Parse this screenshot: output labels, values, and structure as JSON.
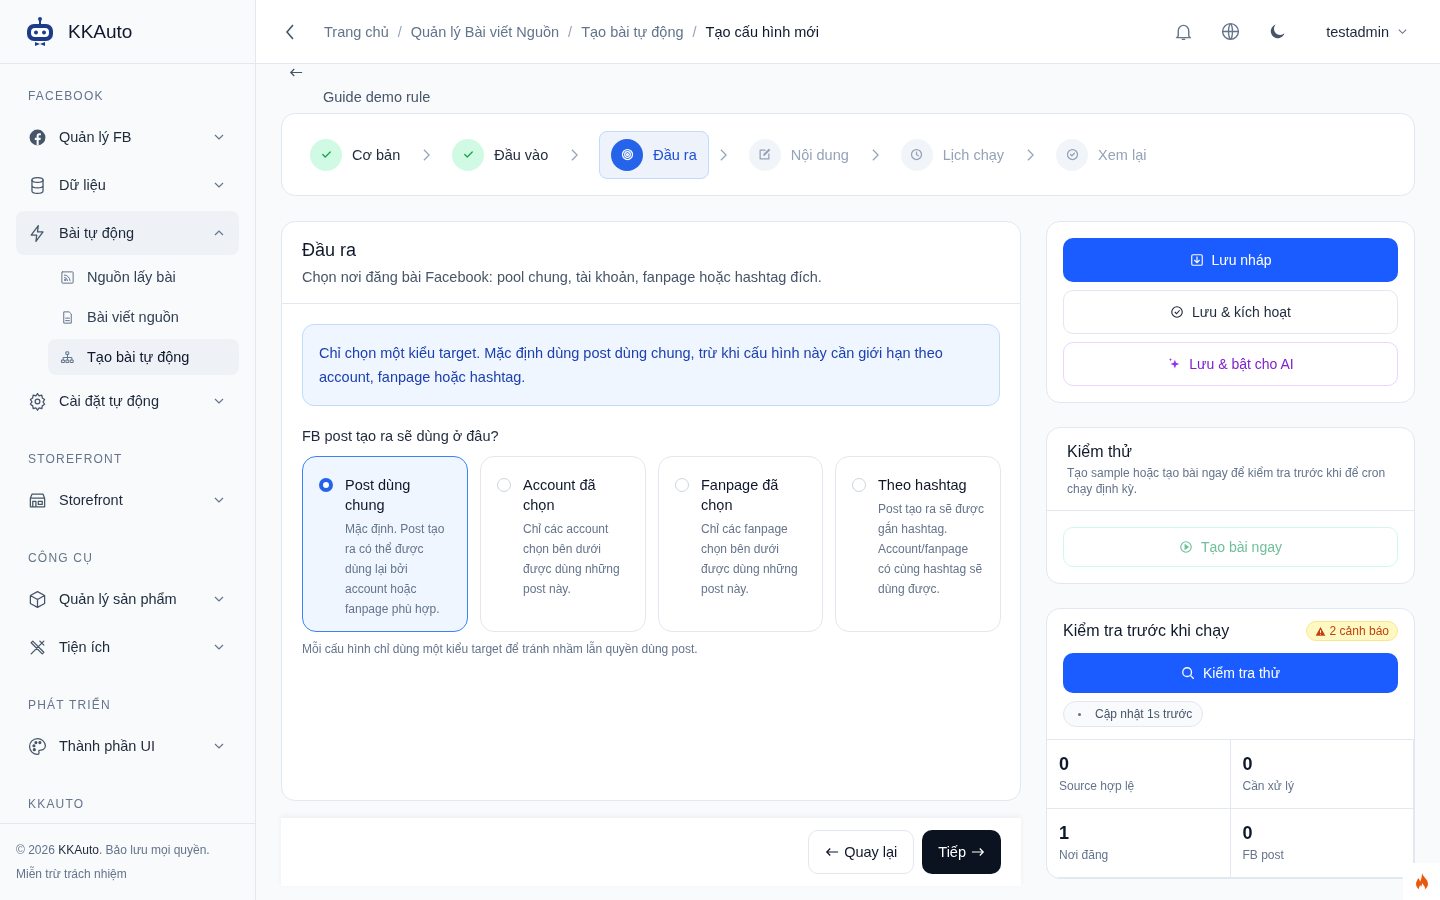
{
  "brand": {
    "name": "KKAuto"
  },
  "sidebar": {
    "sections": [
      {
        "title": "FACEBOOK",
        "items": [
          {
            "label": "Quản lý FB",
            "expanded": false
          },
          {
            "label": "Dữ liệu",
            "expanded": false
          },
          {
            "label": "Bài tự động",
            "expanded": true,
            "children": [
              {
                "label": "Nguồn lấy bài",
                "selected": false
              },
              {
                "label": "Bài viết nguồn",
                "selected": false
              },
              {
                "label": "Tạo bài tự động",
                "selected": true
              }
            ]
          },
          {
            "label": "Cài đặt tự động",
            "expanded": false
          }
        ]
      },
      {
        "title": "STOREFRONT",
        "items": [
          {
            "label": "Storefront",
            "expanded": false
          }
        ]
      },
      {
        "title": "CÔNG CỤ",
        "items": [
          {
            "label": "Quản lý sản phẩm",
            "expanded": false
          },
          {
            "label": "Tiện ích",
            "expanded": false
          }
        ]
      },
      {
        "title": "PHÁT TRIỂN",
        "items": [
          {
            "label": "Thành phần UI",
            "expanded": false
          }
        ]
      },
      {
        "title": "KKAUTO"
      }
    ],
    "footer": {
      "copyright": "© 2026",
      "brand": "KKAuto",
      "rights": ". Bảo lưu mọi quyền.",
      "disclaimer": "Miễn trừ trách nhiệm"
    }
  },
  "breadcrumb": {
    "separator": "/",
    "items": [
      "Trang chủ",
      "Quản lý Bài viết Nguồn",
      "Tạo bài tự động",
      "Tạo cấu hình mới"
    ]
  },
  "user": {
    "name": "testadmin"
  },
  "page": {
    "subtitle": "Guide demo rule"
  },
  "steps": [
    {
      "label": "Cơ bản",
      "completed": true,
      "selected": false
    },
    {
      "label": "Đầu vào",
      "completed": true,
      "selected": false
    },
    {
      "label": "Đầu ra",
      "completed": false,
      "selected": true
    },
    {
      "label": "Nội dung",
      "completed": false,
      "selected": false
    },
    {
      "label": "Lịch chạy",
      "completed": false,
      "selected": false
    },
    {
      "label": "Xem lại",
      "completed": false,
      "selected": false
    }
  ],
  "output": {
    "title": "Đầu ra",
    "description": "Chọn nơi đăng bài Facebook: pool chung, tài khoản, fanpage hoặc hashtag đích.",
    "info": "Chỉ chọn một kiểu target. Mặc định dùng post dùng chung, trừ khi cấu hình này cần giới hạn theo account, fanpage hoặc hashtag.",
    "question": "FB post tạo ra sẽ dùng ở đâu?",
    "options": [
      {
        "title": "Post dùng chung",
        "description": "Mặc định. Post tạo ra có thể được dùng lại bởi account hoặc fanpage phù hợp.",
        "selected": true
      },
      {
        "title": "Account đã chọn",
        "description": "Chỉ các account chọn bên dưới được dùng những post này.",
        "selected": false
      },
      {
        "title": "Fanpage đã chọn",
        "description": "Chỉ các fanpage chọn bên dưới được dùng những post này.",
        "selected": false
      },
      {
        "title": "Theo hashtag",
        "description": "Post tạo ra sẽ được gắn hashtag. Account/fanpage có cùng hashtag sẽ dùng được.",
        "selected": false
      }
    ],
    "note": "Mỗi cấu hình chỉ dùng một kiểu target để tránh nhầm lẫn quyền dùng post."
  },
  "nav": {
    "back": "Quay lại",
    "next": "Tiếp"
  },
  "actions": [
    {
      "kind": "primary",
      "label": "Lưu nháp"
    },
    {
      "kind": "outline",
      "label": "Lưu & kích hoạt"
    },
    {
      "kind": "ai",
      "label": "Lưu & bật cho AI"
    }
  ],
  "test": {
    "title": "Kiểm thử",
    "description": "Tạo sample hoặc tạo bài ngay để kiểm tra trước khi để cron chạy định kỳ.",
    "button": "Tạo bài ngay"
  },
  "precheck": {
    "title": "Kiểm tra trước khi chạy",
    "badge": "2 cảnh báo",
    "button": "Kiểm tra thử",
    "updated": "Cập nhật 1s trước",
    "stats": [
      {
        "value": "0",
        "label": "Source hợp lệ"
      },
      {
        "value": "0",
        "label": "Cần xử lý"
      },
      {
        "value": "1",
        "label": "Nơi đăng"
      },
      {
        "value": "0",
        "label": "FB post"
      }
    ]
  }
}
